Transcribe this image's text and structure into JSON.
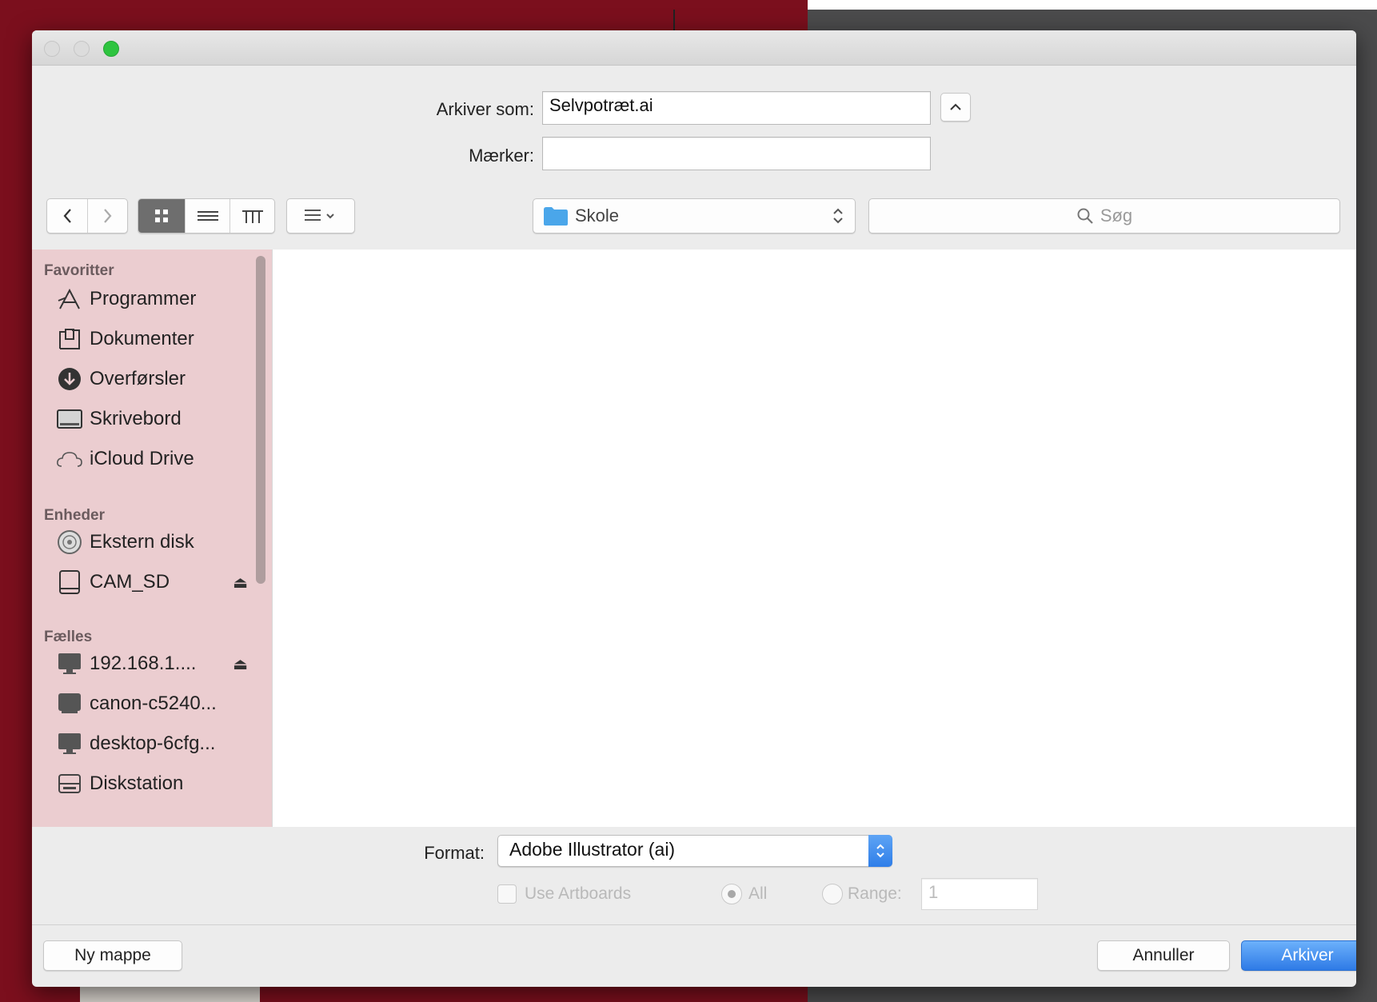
{
  "dialog": {
    "save_as_label": "Arkiver som:",
    "save_as_value": "Selvpotræt.ai",
    "tags_label": "Mærker:",
    "tags_value": "",
    "location": "Skole",
    "search_placeholder": "Søg"
  },
  "sidebar": {
    "sections": [
      {
        "title": "Favoritter",
        "items": [
          {
            "label": "Programmer",
            "icon": "applications-icon"
          },
          {
            "label": "Dokumenter",
            "icon": "documents-icon"
          },
          {
            "label": "Overførsler",
            "icon": "downloads-icon"
          },
          {
            "label": "Skrivebord",
            "icon": "desktop-icon"
          },
          {
            "label": "iCloud Drive",
            "icon": "icloud-icon"
          }
        ]
      },
      {
        "title": "Enheder",
        "items": [
          {
            "label": "Ekstern disk",
            "icon": "disk-icon"
          },
          {
            "label": "CAM_SD",
            "icon": "drive-icon",
            "eject": true
          }
        ]
      },
      {
        "title": "Fælles",
        "items": [
          {
            "label": "192.168.1....",
            "icon": "computer-icon",
            "eject": true
          },
          {
            "label": "canon-c5240...",
            "icon": "computer-icon"
          },
          {
            "label": "desktop-6cfg...",
            "icon": "computer-icon"
          },
          {
            "label": "Diskstation",
            "icon": "server-icon"
          }
        ]
      }
    ]
  },
  "format": {
    "label": "Format:",
    "value": "Adobe Illustrator (ai)"
  },
  "artboards": {
    "use_label": "Use Artboards",
    "use_checked": false,
    "all_label": "All",
    "range_label": "Range:",
    "range_value": "1"
  },
  "buttons": {
    "new_folder": "Ny mappe",
    "cancel": "Annuller",
    "save": "Arkiver"
  },
  "colors": {
    "sidebar_bg": "#ebcdd0",
    "accent": "#2e7ae6",
    "background_left": "#7b0f1d",
    "background_right": "#4b4b4c"
  }
}
